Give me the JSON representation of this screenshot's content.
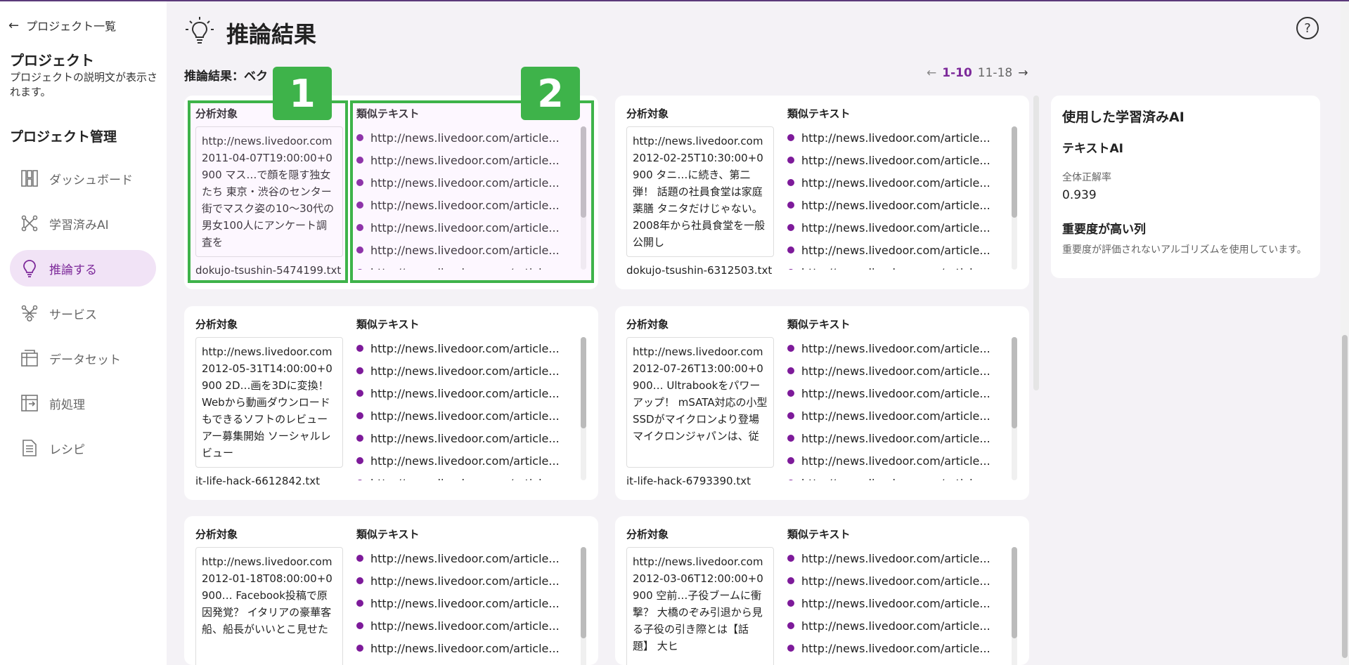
{
  "sidebar": {
    "back_label": "プロジェクト一覧",
    "project_title": "プロジェクト",
    "project_desc": "プロジェクトの説明文が表示されます。",
    "section_title": "プロジェクト管理",
    "nav": [
      {
        "label": "ダッシュボード",
        "icon": "dashboard-icon",
        "active": false
      },
      {
        "label": "学習済みAI",
        "icon": "trained-ai-icon",
        "active": false
      },
      {
        "label": "推論する",
        "icon": "lightbulb-icon",
        "active": true
      },
      {
        "label": "サービス",
        "icon": "service-icon",
        "active": false
      },
      {
        "label": "データセット",
        "icon": "dataset-icon",
        "active": false
      },
      {
        "label": "前処理",
        "icon": "preprocess-icon",
        "active": false
      },
      {
        "label": "レシピ",
        "icon": "recipe-icon",
        "active": false
      }
    ]
  },
  "header": {
    "title": "推論結果",
    "result_label": "推論結果：ベク"
  },
  "pager": {
    "current": "1-10",
    "other": "11-18"
  },
  "labels": {
    "target": "分析対象",
    "similar": "類似テキスト"
  },
  "badges": {
    "one": "1",
    "two": "2"
  },
  "cards": [
    {
      "target_text": "http://news.livedoor.com 2011-04-07T19:00:00+0900 マス…で顔を隠す独女たち 東京・渋谷のセンター街でマスク姿の10〜30代の男女100人にアンケート調査を",
      "filename": "dokujo-tsushin-5474199.txt",
      "similar": [
        "http://news.livedoor.com/article...",
        "http://news.livedoor.com/article...",
        "http://news.livedoor.com/article...",
        "http://news.livedoor.com/article...",
        "http://news.livedoor.com/article...",
        "http://news.livedoor.com/article...",
        "http://news.livedoor.com/article..."
      ]
    },
    {
      "target_text": "http://news.livedoor.com 2012-02-25T10:30:00+0900 タニ…に続き、第二弾！ 話題の社員食堂は家庭薬膳 タニタだけじゃない。2008年から社員食堂を一般公開し",
      "filename": "dokujo-tsushin-6312503.txt",
      "similar": [
        "http://news.livedoor.com/article...",
        "http://news.livedoor.com/article...",
        "http://news.livedoor.com/article...",
        "http://news.livedoor.com/article...",
        "http://news.livedoor.com/article...",
        "http://news.livedoor.com/article...",
        "http://news.livedoor.com/article..."
      ]
    },
    {
      "target_text": "http://news.livedoor.com 2012-05-31T14:00:00+0900 2D…画を3Dに変換！Webから動画ダウンロードもできるソフトのレビューアー募集開始 ソーシャルレビュー",
      "filename": "it-life-hack-6612842.txt",
      "similar": [
        "http://news.livedoor.com/article...",
        "http://news.livedoor.com/article...",
        "http://news.livedoor.com/article...",
        "http://news.livedoor.com/article...",
        "http://news.livedoor.com/article...",
        "http://news.livedoor.com/article...",
        "http://news.livedoor.com/article..."
      ]
    },
    {
      "target_text": "http://news.livedoor.com 2012-07-26T13:00:00+0900… Ultrabookをパワーアップ！ mSATA対応の小型SSDがマイクロンより登場 マイクロンジャパンは、従",
      "filename": "it-life-hack-6793390.txt",
      "similar": [
        "http://news.livedoor.com/article...",
        "http://news.livedoor.com/article...",
        "http://news.livedoor.com/article...",
        "http://news.livedoor.com/article...",
        "http://news.livedoor.com/article...",
        "http://news.livedoor.com/article...",
        "http://news.livedoor.com/article..."
      ]
    },
    {
      "target_text": "http://news.livedoor.com 2012-01-18T08:00:00+0900… Facebook投稿で原因発覚？ イタリアの豪華客船、船長がいいとこ見せた",
      "filename": "",
      "similar": [
        "http://news.livedoor.com/article...",
        "http://news.livedoor.com/article...",
        "http://news.livedoor.com/article...",
        "http://news.livedoor.com/article...",
        "http://news.livedoor.com/article..."
      ]
    },
    {
      "target_text": "http://news.livedoor.com 2012-03-06T12:00:00+0900 空前…子役ブームに衝撃？ 大橋のぞみ引退から見る子役の引き際とは【話題】 大ヒ",
      "filename": "",
      "similar": [
        "http://news.livedoor.com/article...",
        "http://news.livedoor.com/article...",
        "http://news.livedoor.com/article...",
        "http://news.livedoor.com/article...",
        "http://news.livedoor.com/article..."
      ]
    }
  ],
  "panel": {
    "title": "使用した学習済みAI",
    "ai_type": "テキストAI",
    "metric_label": "全体正解率",
    "metric_value": "0.939",
    "importance_title": "重要度が高い列",
    "importance_note": "重要度が評価されないアルゴリズムを使用しています。"
  },
  "help": "?"
}
